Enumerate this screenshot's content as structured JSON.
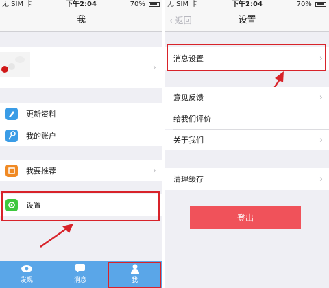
{
  "status": {
    "carrier": "无 SIM 卡",
    "time": "下午2:04",
    "battery": "70%"
  },
  "left": {
    "title": "我",
    "items": [
      {
        "label": "更新资料"
      },
      {
        "label": "我的账户"
      },
      {
        "label": "我要推荐"
      },
      {
        "label": "设置"
      }
    ],
    "tabs": [
      {
        "label": "发现",
        "icon": "eye-icon"
      },
      {
        "label": "消息",
        "icon": "chat-icon"
      },
      {
        "label": "我",
        "icon": "person-icon"
      }
    ]
  },
  "right": {
    "back": "返回",
    "title": "设置",
    "items": [
      {
        "label": "消息设置"
      },
      {
        "label": "意见反馈"
      },
      {
        "label": "给我们评价"
      },
      {
        "label": "关于我们"
      },
      {
        "label": "清理缓存"
      }
    ],
    "logout": "登出"
  },
  "colors": {
    "accent_blue": "#5aa6e8",
    "highlight_red": "#d8232a",
    "logout_red": "#f0525a",
    "settings_green": "#3ec83e"
  }
}
